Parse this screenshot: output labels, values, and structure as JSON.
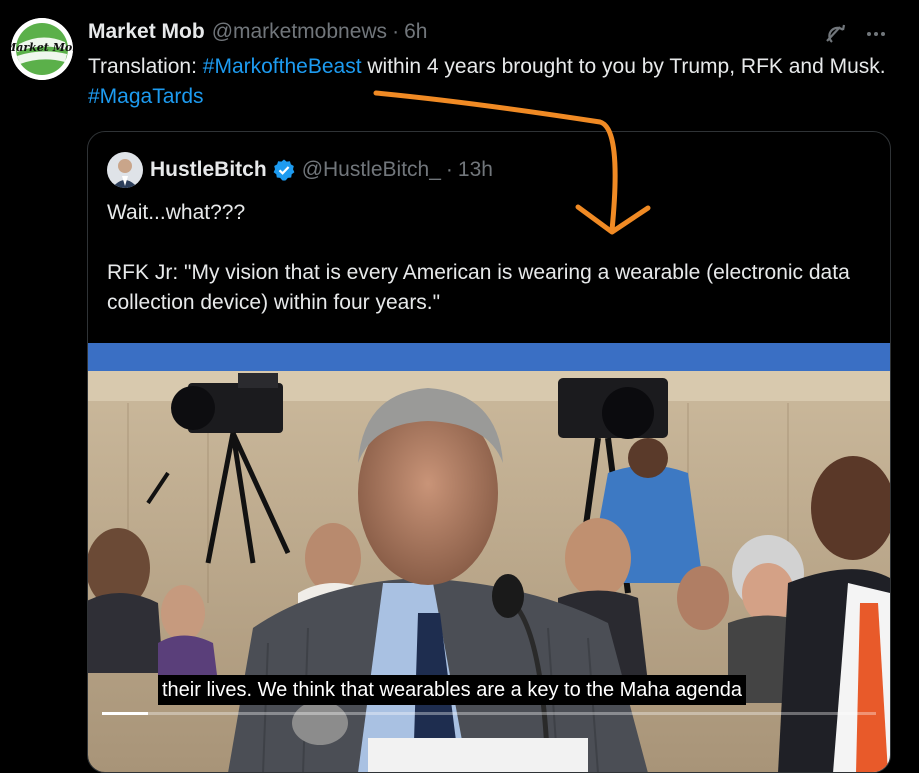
{
  "tweet": {
    "author_name": "Market Mob",
    "handle": "@marketmobnews",
    "separator": "·",
    "time": "6h",
    "text_before": "Translation: ",
    "hashtag1": "#MarkoftheBeast",
    "text_middle": " within 4 years brought to you by Trump, RFK and Musk. ",
    "hashtag2": "#MagaTards",
    "avatar_text": "Market Mob",
    "icons": [
      "grok-icon",
      "more-icon"
    ]
  },
  "quote": {
    "author_name": "HustleBitch",
    "handle": "@HustleBitch_",
    "separator": "·",
    "time": "13h",
    "text": "Wait...what???\n\nRFK Jr:  \"My vision that is every American is wearing a wearable (electronic data collection device) within four years.\"",
    "verified_icon": "verified-badge-icon"
  },
  "video": {
    "caption": "their lives. We think that wearables are a key to the Maha agenda",
    "progress": 0.06
  },
  "colors": {
    "background": "#000000",
    "link": "#1d9bf0",
    "muted": "#71767b",
    "arrow": "#f08a24",
    "verified": "#1d9bf0"
  }
}
